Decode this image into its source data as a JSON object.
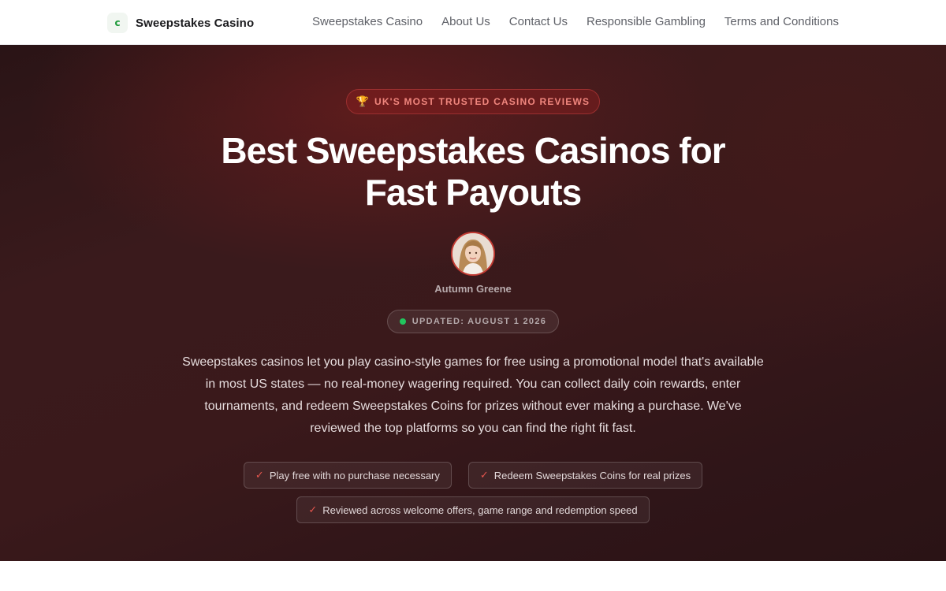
{
  "brand": {
    "logo_letter": "c",
    "name": "Sweepstakes Casino"
  },
  "nav": {
    "items": [
      {
        "label": "Sweepstakes Casino"
      },
      {
        "label": "About Us"
      },
      {
        "label": "Contact Us"
      },
      {
        "label": "Responsible Gambling"
      },
      {
        "label": "Terms and Conditions"
      }
    ]
  },
  "hero": {
    "badge_icon": "trophy-icon",
    "badge_text": "UK'S MOST TRUSTED CASINO REVIEWS",
    "title_line1": "Best Sweepstakes Casinos for",
    "title_line2": "Fast Payouts",
    "author": "Autumn Greene",
    "updated": "UPDATED: AUGUST 1 2026",
    "intro": "Sweepstakes casinos let you play casino-style games for free using a promotional model that's available in most US states — no real-money wagering required. You can collect daily coin rewards, enter tournaments, and redeem Sweepstakes Coins for prizes without ever making a purchase. We've reviewed the top platforms so you can find the right fit fast.",
    "features": [
      "Play free with no purchase necessary",
      "Redeem Sweepstakes Coins for real prizes",
      "Reviewed across welcome offers, game range and redemption speed"
    ]
  },
  "colors": {
    "accent": "#c23a32",
    "badge_text": "#f0867e",
    "status_dot": "#22c55e",
    "hero_bg": "#361a1c",
    "logo_green": "#1e9a3a"
  }
}
